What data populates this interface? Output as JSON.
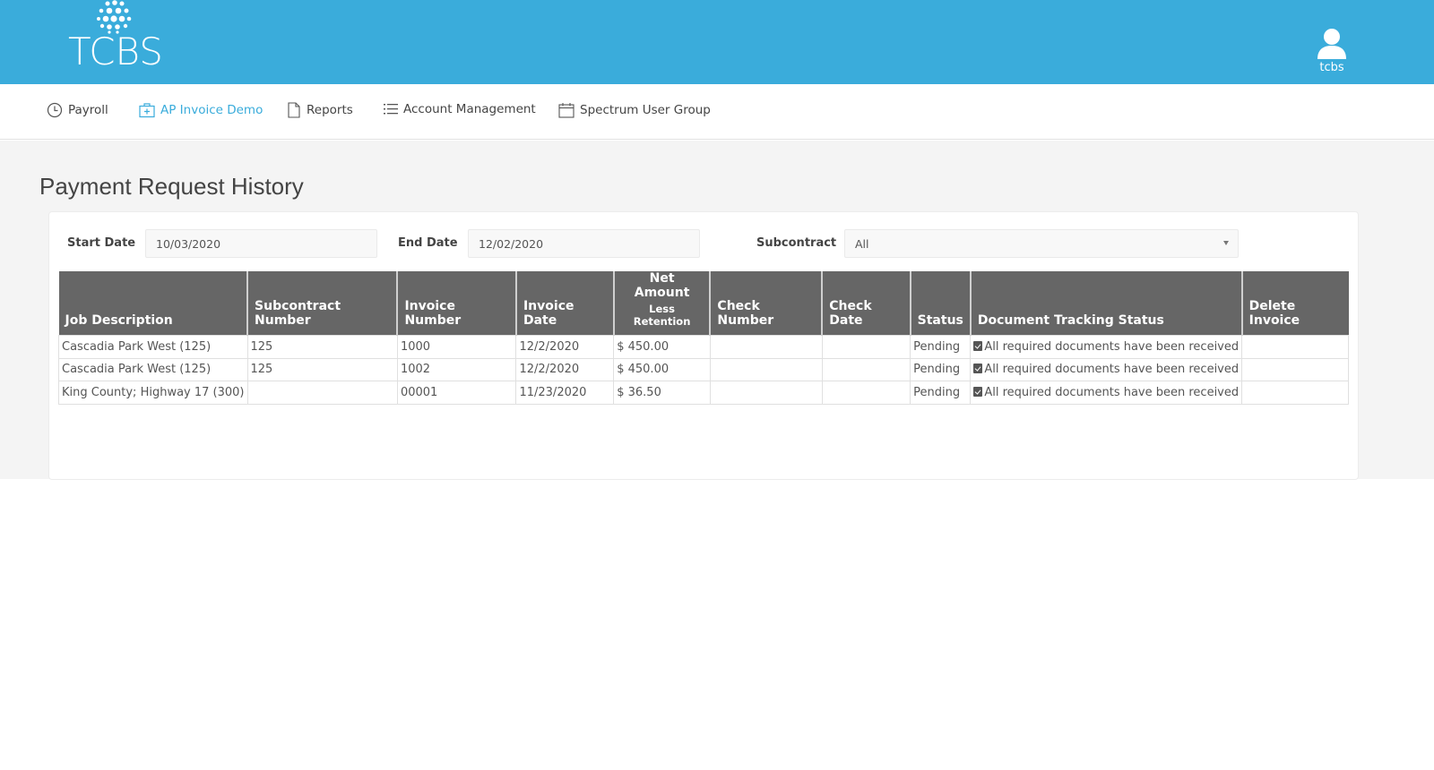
{
  "header": {
    "logo_text": "TCBS",
    "user_name": "tcbs",
    "colors": {
      "brand": "#3aacdb"
    }
  },
  "nav": {
    "items": [
      {
        "label": "Payroll",
        "icon": "clock-icon",
        "active": false
      },
      {
        "label": "AP Invoice Demo",
        "icon": "briefcase-plus-icon",
        "active": true
      },
      {
        "label": "Reports",
        "icon": "document-icon",
        "active": false
      },
      {
        "label": "Account Management",
        "icon": "list-icon",
        "active": false
      },
      {
        "label": "Spectrum User Group",
        "icon": "calendar-icon",
        "active": false
      }
    ]
  },
  "page": {
    "title": "Payment Request History"
  },
  "filters": {
    "start_date_label": "Start Date",
    "start_date_value": "10/03/2020",
    "end_date_label": "End Date",
    "end_date_value": "12/02/2020",
    "subcontract_label": "Subcontract",
    "subcontract_value": "All"
  },
  "table": {
    "columns": [
      {
        "label": "Job Description"
      },
      {
        "label": "Subcontract Number"
      },
      {
        "label": "Invoice Number"
      },
      {
        "label": "Invoice Date"
      },
      {
        "label": "Net Amount",
        "sub": "Less Retention"
      },
      {
        "label": "Check Number"
      },
      {
        "label": "Check Date"
      },
      {
        "label": "Status"
      },
      {
        "label": "Document Tracking Status"
      },
      {
        "label": "Delete Invoice"
      }
    ],
    "rows": [
      {
        "job": "Cascadia Park West (125)",
        "subcontract": "125",
        "invoice_number": "1000",
        "invoice_date": "12/2/2020",
        "net_amount": "$ 450.00",
        "check_number": "",
        "check_date": "",
        "status": "Pending",
        "doc_status": "All required documents have been received",
        "delete": ""
      },
      {
        "job": "Cascadia Park West (125)",
        "subcontract": "125",
        "invoice_number": "1002",
        "invoice_date": "12/2/2020",
        "net_amount": "$ 450.00",
        "check_number": "",
        "check_date": "",
        "status": "Pending",
        "doc_status": "All required documents have been received",
        "delete": ""
      },
      {
        "job": "King County; Highway 17 (300)",
        "subcontract": "",
        "invoice_number": "00001",
        "invoice_date": "11/23/2020",
        "net_amount": "$ 36.50",
        "check_number": "",
        "check_date": "",
        "status": "Pending",
        "doc_status": "All required documents have been received",
        "delete": ""
      }
    ]
  }
}
